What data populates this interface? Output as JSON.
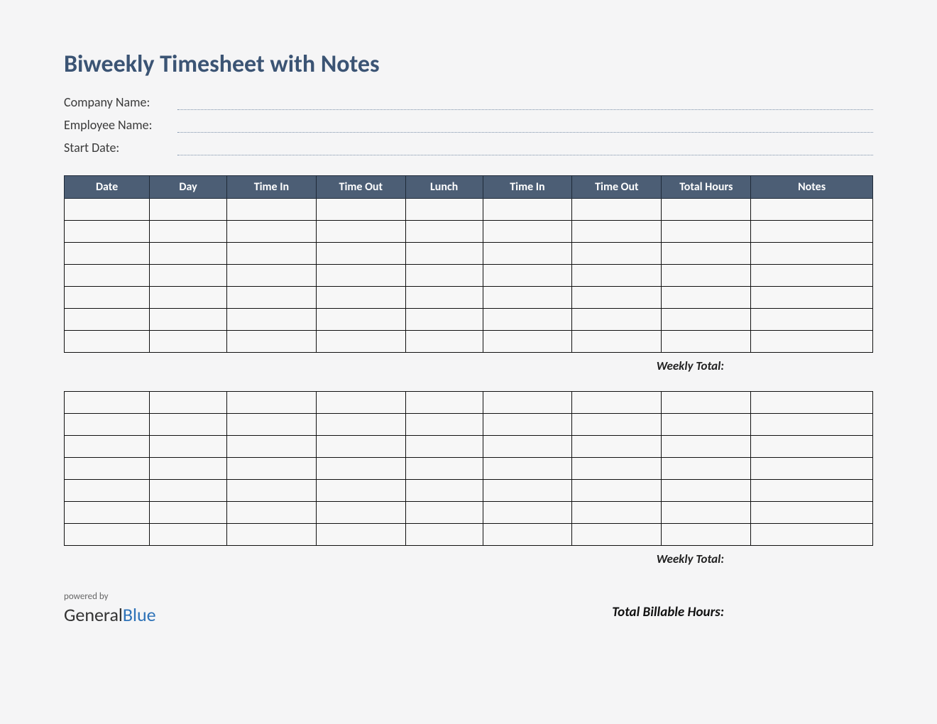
{
  "title": "Biweekly Timesheet with Notes",
  "info": {
    "company_label": "Company Name:",
    "employee_label": "Employee Name:",
    "startdate_label": "Start Date:"
  },
  "columns": {
    "date": "Date",
    "day": "Day",
    "time_in": "Time In",
    "time_out": "Time Out",
    "lunch": "Lunch",
    "time_in2": "Time In",
    "time_out2": "Time Out",
    "total_hours": "Total Hours",
    "notes": "Notes"
  },
  "week1": {
    "rows": [
      "",
      "",
      "",
      "",
      "",
      "",
      ""
    ],
    "weekly_total_label": "Weekly Total:"
  },
  "week2": {
    "rows": [
      "",
      "",
      "",
      "",
      "",
      "",
      ""
    ],
    "weekly_total_label": "Weekly Total:"
  },
  "footer": {
    "powered_by": "powered by",
    "brand_general": "General",
    "brand_blue": "Blue",
    "total_billable_label": "Total Billable Hours:"
  }
}
